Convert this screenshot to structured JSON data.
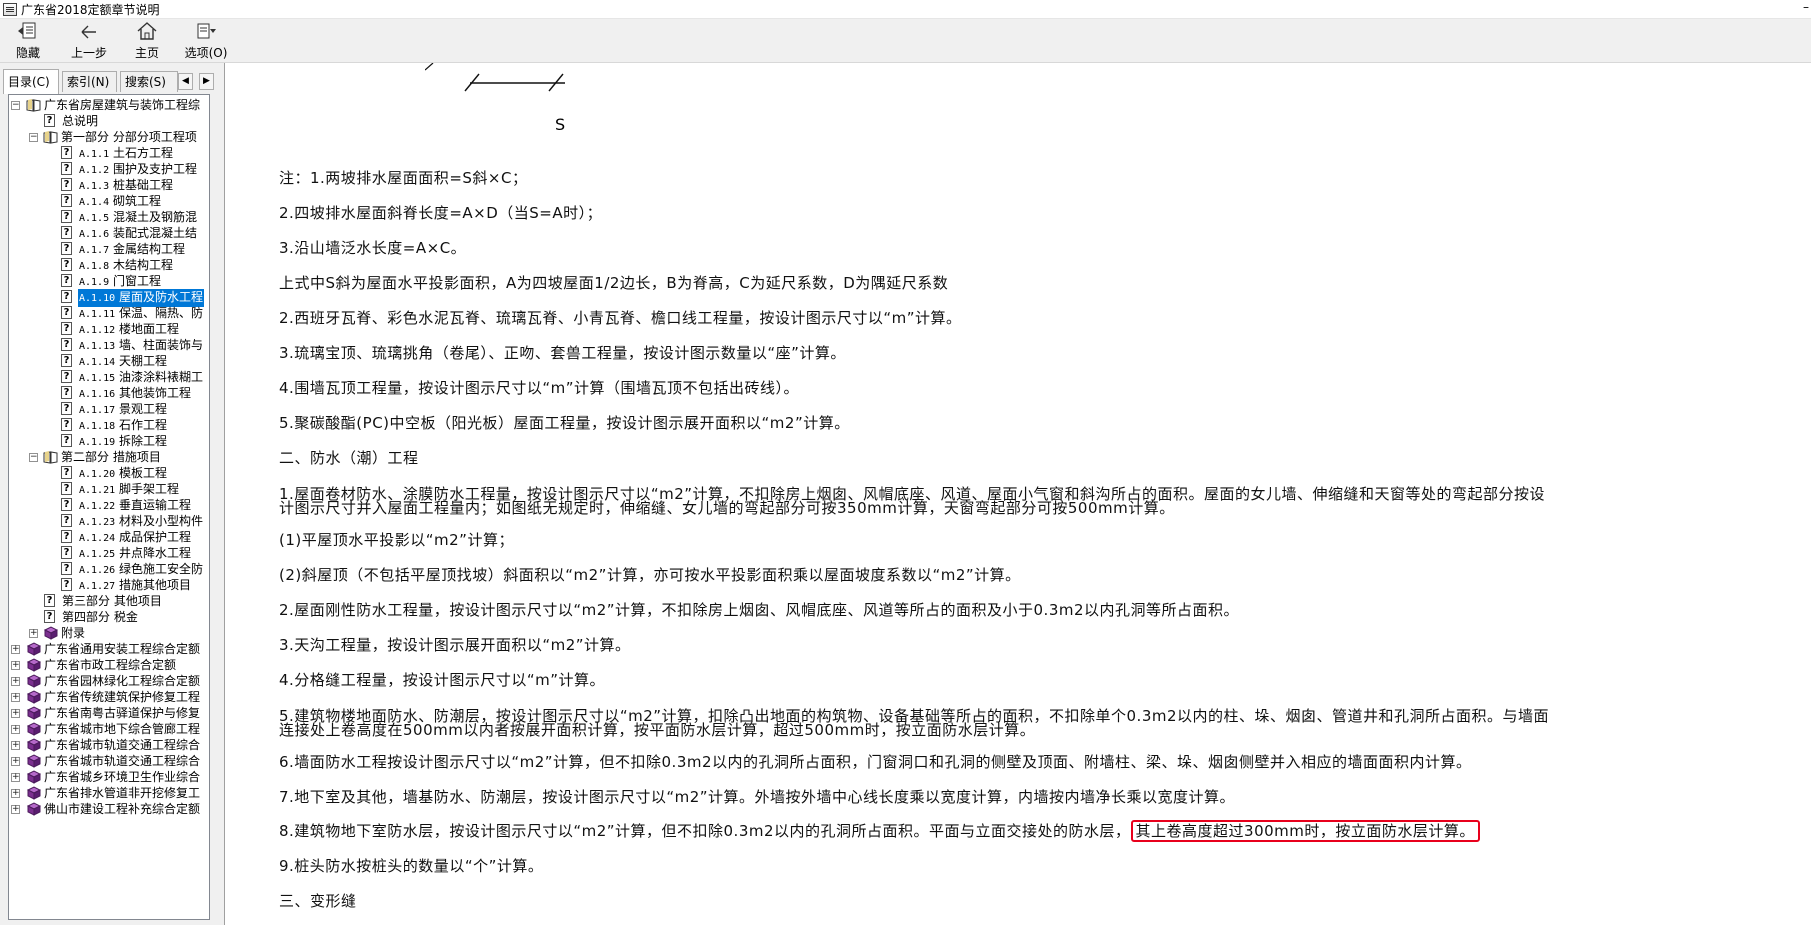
{
  "window": {
    "title": "广东省2018定额章节说明",
    "minimize_glyph": "–"
  },
  "toolbar": {
    "hide_label": "隐藏",
    "back_label": "上一步",
    "home_label": "主页",
    "options_label": "选项(O)"
  },
  "tabs": {
    "contents": "目录(C)",
    "index": "索引(N)",
    "search": "搜索(S)",
    "scroll_left": "◀",
    "scroll_right": "▶"
  },
  "tree": {
    "root_book": "广东省房屋建筑与装饰工程综",
    "general": "总说明",
    "part1": "第一部分  分部分项工程项",
    "part1_items": [
      {
        "code": "A.1.1",
        "name": "土石方工程"
      },
      {
        "code": "A.1.2",
        "name": "围护及支护工程"
      },
      {
        "code": "A.1.3",
        "name": "桩基础工程"
      },
      {
        "code": "A.1.4",
        "name": "砌筑工程"
      },
      {
        "code": "A.1.5",
        "name": "混凝土及钢筋混"
      },
      {
        "code": "A.1.6",
        "name": "装配式混凝土结"
      },
      {
        "code": "A.1.7",
        "name": "金属结构工程"
      },
      {
        "code": "A.1.8",
        "name": "木结构工程"
      },
      {
        "code": "A.1.9",
        "name": "门窗工程"
      },
      {
        "code": "A.1.10",
        "name": "屋面及防水工程"
      },
      {
        "code": "A.1.11",
        "name": "保温、隔热、防"
      },
      {
        "code": "A.1.12",
        "name": "楼地面工程"
      },
      {
        "code": "A.1.13",
        "name": "墙、柱面装饰与"
      },
      {
        "code": "A.1.14",
        "name": "天棚工程"
      },
      {
        "code": "A.1.15",
        "name": "油漆涂料裱糊工"
      },
      {
        "code": "A.1.16",
        "name": "其他装饰工程"
      },
      {
        "code": "A.1.17",
        "name": "景观工程"
      },
      {
        "code": "A.1.18",
        "name": "石作工程"
      },
      {
        "code": "A.1.19",
        "name": "拆除工程"
      }
    ],
    "part2": "第二部分  措施项目",
    "part2_items": [
      {
        "code": "A.1.20",
        "name": "模板工程"
      },
      {
        "code": "A.1.21",
        "name": "脚手架工程"
      },
      {
        "code": "A.1.22",
        "name": "垂直运输工程"
      },
      {
        "code": "A.1.23",
        "name": "材料及小型构件"
      },
      {
        "code": "A.1.24",
        "name": "成品保护工程"
      },
      {
        "code": "A.1.25",
        "name": "井点降水工程"
      },
      {
        "code": "A.1.26",
        "name": "绿色施工安全防"
      },
      {
        "code": "A.1.27",
        "name": "措施其他项目"
      }
    ],
    "part3": "第三部分  其他项目",
    "part4": "第四部分  税金",
    "appendix": "附录",
    "other_books": [
      "广东省通用安装工程综合定额",
      "广东省市政工程综合定额",
      "广东省园林绿化工程综合定额",
      "广东省传统建筑保护修复工程",
      "广东省南粤古驿道保护与修复",
      "广东省城市地下综合管廊工程",
      "广东省城市轨道交通工程综合",
      "广东省城市轨道交通工程综合",
      "广东省城乡环境卫生作业综合",
      "广东省排水管道非开挖修复工",
      "佛山市建设工程补充综合定额"
    ],
    "selected_code": "A.1.10"
  },
  "content": {
    "figure_label": "S",
    "lines": [
      "注：1.两坡排水屋面面积=S斜×C；",
      "2.四坡排水屋面斜脊长度=A×D（当S=A时）；",
      "3.沿山墙泛水长度=A×C。",
      "上式中S斜为屋面水平投影面积，A为四坡屋面1/2边长，B为脊高，C为延尺系数，D为隅延尺系数",
      "2.西班牙瓦脊、彩色水泥瓦脊、琉璃瓦脊、小青瓦脊、檐口线工程量，按设计图示尺寸以“m”计算。",
      "3.琉璃宝顶、琉璃挑角（卷尾）、正吻、套兽工程量，按设计图示数量以“座”计算。",
      "4.围墙瓦顶工程量，按设计图示尺寸以“m”计算（围墙瓦顶不包括出砖线）。",
      "5.聚碳酸酯(PC)中空板（阳光板）屋面工程量，按设计图示展开面积以“m2”计算。",
      "二、防水（潮）工程"
    ],
    "para1a": "1.屋面卷材防水、涂膜防水工程量，按设计图示尺寸以“m2”计算，不扣除房上烟囱、风帽底座、风道、屋面小气窗和斜沟所占的面积。屋面的女儿墙、伸缩缝和天窗等处的弯起部分按设",
    "para1b": "计图示尺寸并入屋面工程量内；如图纸无规定时，伸缩缝、女儿墙的弯起部分可按350mm计算，天窗弯起部分可按500mm计算。",
    "lines2": [
      "(1)平屋顶水平投影以“m2”计算；",
      "(2)斜屋顶（不包括平屋顶找坡）斜面积以“m2”计算，亦可按水平投影面积乘以屋面坡度系数以“m2”计算。",
      "2.屋面刚性防水工程量，按设计图示尺寸以“m2”计算，不扣除房上烟囱、风帽底座、风道等所占的面积及小于0.3m2以内孔洞等所占面积。",
      "3.天沟工程量，按设计图示展开面积以“m2”计算。",
      "4.分格缝工程量，按设计图示尺寸以“m”计算。"
    ],
    "para5a": "5.建筑物楼地面防水、防潮层，按设计图示尺寸以“m2”计算，扣除凸出地面的构筑物、设备基础等所占的面积，不扣除单个0.3m2以内的柱、垛、烟囱、管道井和孔洞所占面积。与墙面",
    "para5b": "连接处上卷高度在500mm以内者按展开面积计算，按平面防水层计算，超过500mm时，按立面防水层计算。",
    "lines3": [
      "6.墙面防水工程按设计图示尺寸以“m2”计算，但不扣除0.3m2以内的孔洞所占面积，门窗洞口和孔洞的侧壁及顶面、附墙柱、梁、垛、烟囱侧壁并入相应的墙面面积内计算。",
      "7.地下室及其他，墙基防水、防潮层，按设计图示尺寸以“m2”计算。外墙按外墙中心线长度乘以宽度计算，内墙按内墙净长乘以宽度计算。"
    ],
    "para8_pre": "8.建筑物地下室防水层，按设计图示尺寸以“m2”计算，但不扣除0.3m2以内的孔洞所占面积。平面与立面交接处的防水层，",
    "para8_highlight": "其上卷高度超过300mm时，按立面防水层计算。",
    "lines4": [
      "9.桩头防水按桩头的数量以“个”计算。",
      "三、变形缝"
    ]
  },
  "colors": {
    "selection": "#0078d7",
    "highlight_border": "#e8001c",
    "book_icon": "#7b2f8f"
  }
}
